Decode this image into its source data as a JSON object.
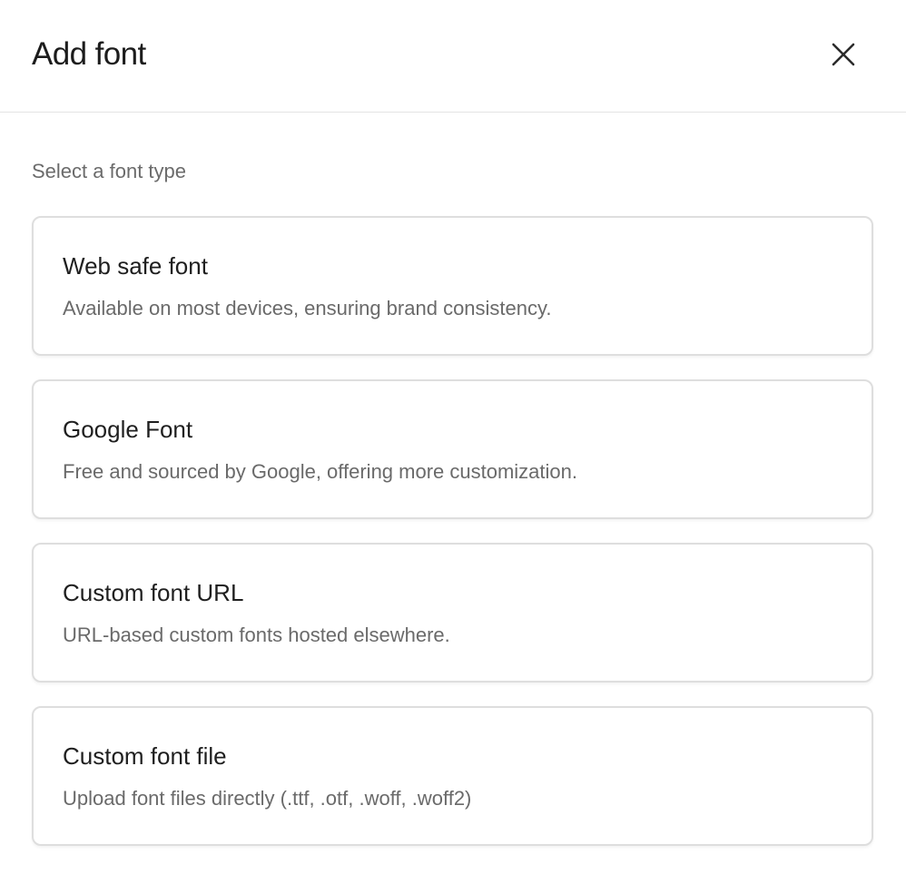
{
  "dialog": {
    "title": "Add font",
    "close_icon": "close-icon"
  },
  "subtitle": "Select a font type",
  "options": [
    {
      "title": "Web safe font",
      "description": "Available on most devices, ensuring brand consistency."
    },
    {
      "title": "Google Font",
      "description": "Free and sourced by Google, offering more customization."
    },
    {
      "title": "Custom font URL",
      "description": "URL-based custom fonts hosted elsewhere."
    },
    {
      "title": "Custom font file",
      "description": "Upload font files directly (.ttf, .otf, .woff, .woff2)"
    }
  ],
  "colors": {
    "border": "#dedede",
    "text": "#1f1f1f",
    "muted": "#6a6a6a"
  }
}
